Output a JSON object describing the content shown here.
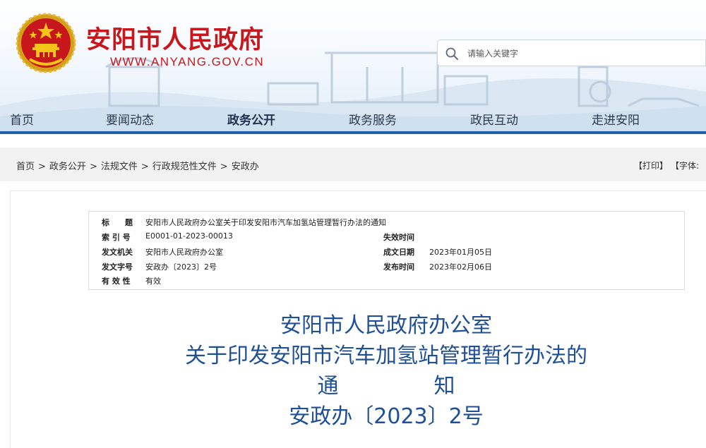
{
  "header": {
    "site_title": "安阳市人民政府",
    "site_domain": "WWW.ANYANG.GOV.CN",
    "search": {
      "placeholder": "请输入关键字"
    },
    "colors": {
      "brand_red": "#c8161d",
      "nav_blue": "#1f5fae"
    }
  },
  "nav": {
    "items": [
      {
        "label": "首页"
      },
      {
        "label": "要闻动态"
      },
      {
        "label": "政务公开",
        "active": true
      },
      {
        "label": "政务服务"
      },
      {
        "label": "政民互动"
      },
      {
        "label": "走进安阳"
      }
    ]
  },
  "breadcrumb": {
    "items": [
      "首页",
      "政务公开",
      "法规文件",
      "行政规范性文件",
      "安政办"
    ],
    "separator": ">"
  },
  "tools": {
    "print": "【打印】",
    "font": "【字体:"
  },
  "meta": {
    "title_label": "标　　题",
    "title_value": "安阳市人民政府办公室关于印发安阳市汽车加氢站管理暂行办法的通知",
    "index_label": "索 引 号",
    "index_value": "E0001-01-2023-00013",
    "expire_label": "失效时间",
    "expire_value": "",
    "issuer_label": "发文机关",
    "issuer_value": "安阳市人民政府办公室",
    "date_label": "成文日期",
    "date_value": "2023年01月05日",
    "docno_label": "发文字号",
    "docno_value": "安政办〔2023〕2号",
    "publish_label": "发布时间",
    "publish_value": "2023年02月06日",
    "valid_label": "有 效 性",
    "valid_value": "有效"
  },
  "document": {
    "title_line1": "安阳市人民政府办公室",
    "title_line2": "关于印发安阳市汽车加氢站管理暂行办法的",
    "title_line3_a": "通",
    "title_line3_b": "知",
    "title_line4": "安政办〔2023〕2号"
  }
}
